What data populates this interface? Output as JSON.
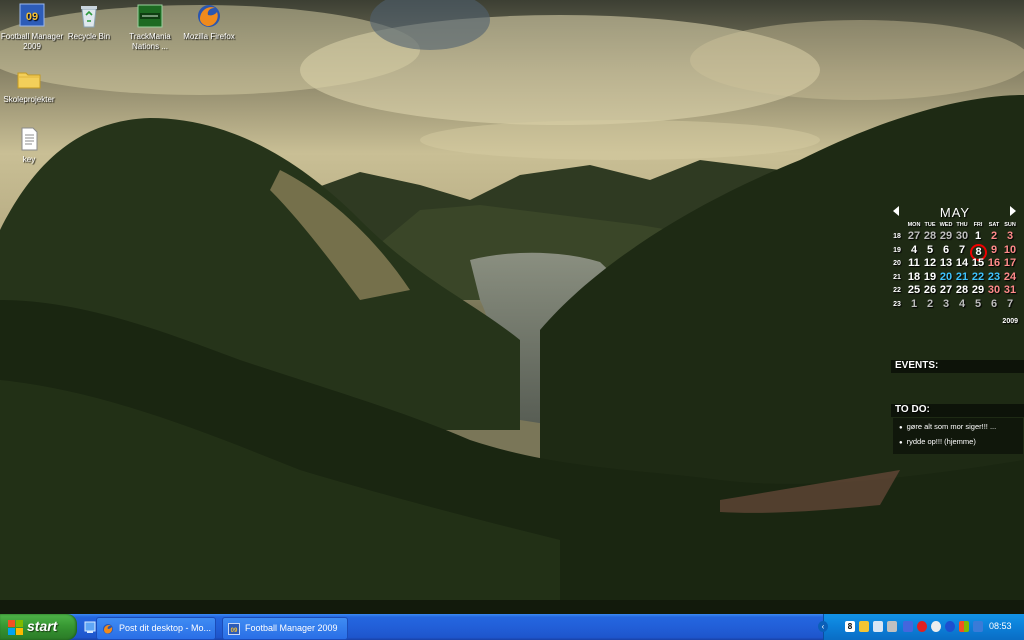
{
  "desktop": {
    "icons": [
      {
        "label": "Football Manager 2009",
        "icon": "football-manager-icon"
      },
      {
        "label": "Recycle Bin",
        "icon": "recycle-bin-icon"
      },
      {
        "label": "TrackMania Nations ...",
        "icon": "trackmania-icon"
      },
      {
        "label": "Mozilla Firefox",
        "icon": "firefox-icon"
      },
      {
        "label": "Skoleprojekter",
        "icon": "folder-icon"
      },
      {
        "label": "key",
        "icon": "text-file-icon"
      }
    ]
  },
  "calendar": {
    "month": "MAY",
    "year": "2009",
    "weekdays": [
      "MON",
      "TUE",
      "WED",
      "THU",
      "FRI",
      "SAT",
      "SUN"
    ],
    "weeks": [
      {
        "wk": "18",
        "days": [
          "27",
          "28",
          "29",
          "30",
          "1",
          "2",
          "3"
        ]
      },
      {
        "wk": "19",
        "days": [
          "4",
          "5",
          "6",
          "7",
          "8",
          "9",
          "10"
        ]
      },
      {
        "wk": "20",
        "days": [
          "11",
          "12",
          "13",
          "14",
          "15",
          "16",
          "17"
        ]
      },
      {
        "wk": "21",
        "days": [
          "18",
          "19",
          "20",
          "21",
          "22",
          "23",
          "24"
        ]
      },
      {
        "wk": "22",
        "days": [
          "25",
          "26",
          "27",
          "28",
          "29",
          "30",
          "31"
        ]
      },
      {
        "wk": "23",
        "days": [
          "1",
          "2",
          "3",
          "4",
          "5",
          "6",
          "7"
        ]
      }
    ],
    "today": "8",
    "colors": {
      "weekend": "#ff8a8a",
      "highlight": "#3ec3ff",
      "today_ring": "#e00000",
      "outside_month": "#bdbdbd"
    }
  },
  "events": {
    "title": "EVENTS:"
  },
  "todo": {
    "title": "TO DO:",
    "items": [
      "gøre alt som mor siger!!! ...",
      "rydde op!!! (hjemme)"
    ]
  },
  "taskbar": {
    "start_label": "start",
    "quick_launch": [
      "show-desktop-icon",
      "firefox-icon"
    ],
    "buttons": [
      {
        "label": "Post dit desktop - Mo...",
        "icon": "firefox-icon"
      },
      {
        "label": "Football Manager 2009",
        "icon": "football-manager-icon"
      }
    ],
    "tray_icons": [
      "back-arrow-icon",
      "app-8-icon",
      "shield-icon",
      "network-icon",
      "tools-icon",
      "antivirus-icon",
      "opera-icon",
      "steam-icon",
      "bluetooth-icon",
      "windows-icon",
      "messenger-icon",
      "display-icon",
      "speaker-icon"
    ],
    "clock": "08:53",
    "colors": {
      "taskbar": "#225fd8",
      "start": "#3a9b35",
      "tray": "#0c7fd8"
    }
  }
}
